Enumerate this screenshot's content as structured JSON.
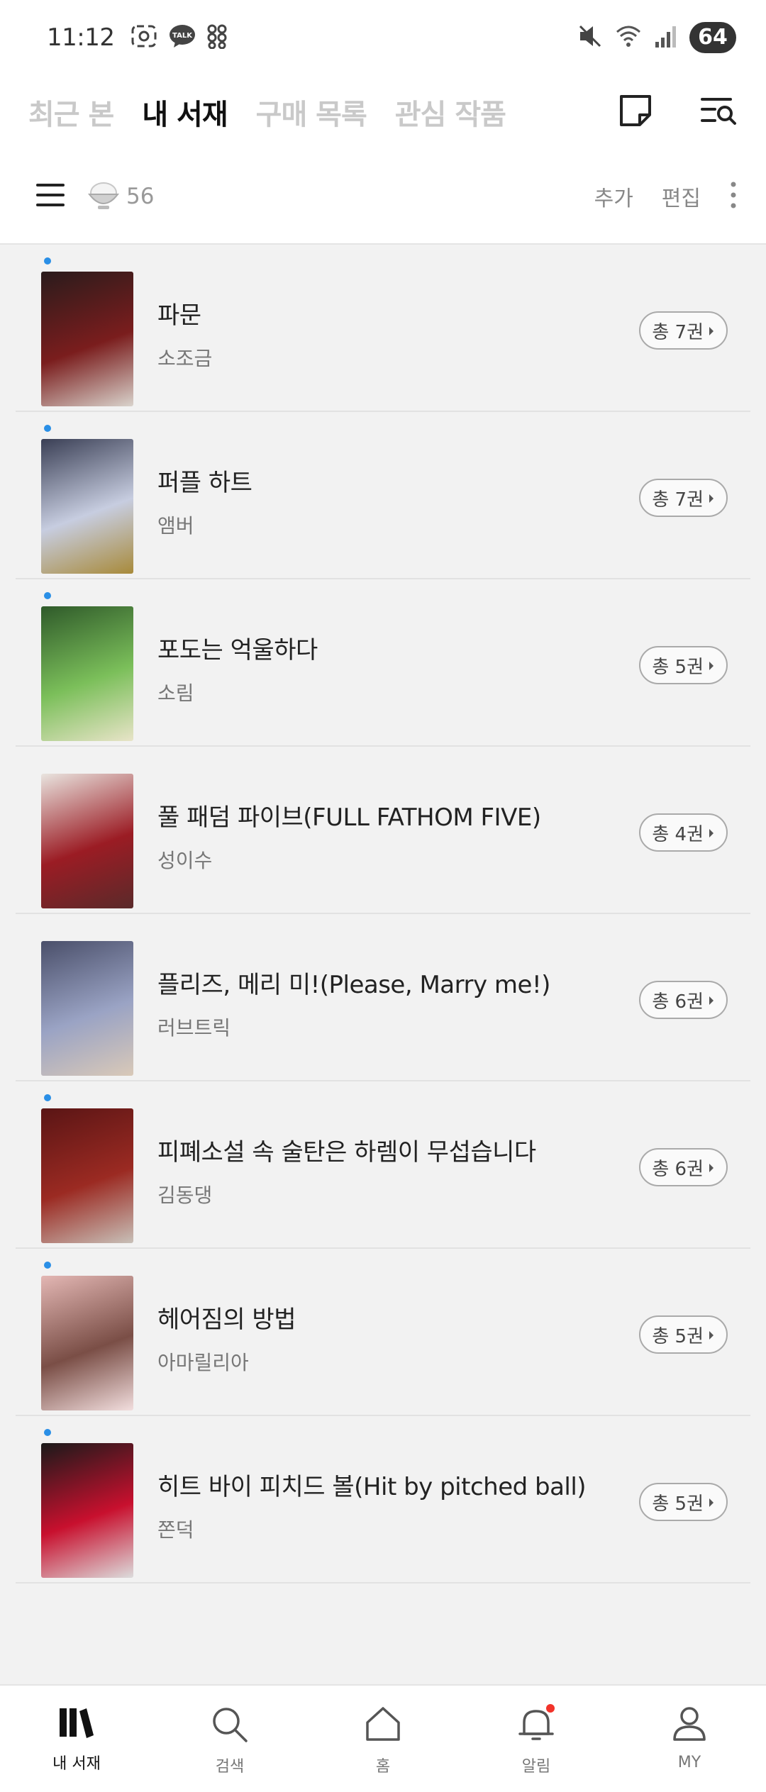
{
  "status_bar": {
    "time": "11:12",
    "battery": "64"
  },
  "top_nav": {
    "tabs": [
      {
        "label": "최근 본",
        "active": false
      },
      {
        "label": "내 서재",
        "active": true
      },
      {
        "label": "구매 목록",
        "active": false
      },
      {
        "label": "관심 작품",
        "active": false
      }
    ],
    "actions": {
      "note_icon": "note-icon",
      "search_list_icon": "list-search-icon"
    }
  },
  "toolbar": {
    "coin_count": "56",
    "add_label": "추가",
    "edit_label": "편집"
  },
  "books": [
    {
      "title": "파문",
      "author": "소조금",
      "volumes": "총 7권",
      "new": true,
      "cover_colors": [
        "#2a1b1c",
        "#7a1d1d",
        "#d9d3cc"
      ]
    },
    {
      "title": "퍼플 하트",
      "author": "앰버",
      "volumes": "총 7권",
      "new": true,
      "cover_colors": [
        "#3a3f55",
        "#c7cde0",
        "#a88a3a"
      ]
    },
    {
      "title": "포도는 억울하다",
      "author": "소림",
      "volumes": "총 5권",
      "new": true,
      "cover_colors": [
        "#2f5a2a",
        "#7bbf5a",
        "#e8e4c8"
      ]
    },
    {
      "title": "풀 패덤 파이브(FULL FATHOM FIVE)",
      "author": "성이수",
      "volumes": "총 4권",
      "new": false,
      "cover_colors": [
        "#e9e4df",
        "#9b1c24",
        "#5a2a2a"
      ]
    },
    {
      "title": "플리즈, 메리 미!(Please, Marry me!)",
      "author": "러브트릭",
      "volumes": "총 6권",
      "new": false,
      "cover_colors": [
        "#4a4f6a",
        "#9aa3c4",
        "#d9c9b8"
      ]
    },
    {
      "title": "피폐소설 속 술탄은 하렘이 무섭습니다",
      "author": "김동댕",
      "volumes": "총 6권",
      "new": true,
      "cover_colors": [
        "#5a1515",
        "#9b2a22",
        "#c8c0b8"
      ]
    },
    {
      "title": "헤어짐의 방법",
      "author": "아마릴리아",
      "volumes": "총 5권",
      "new": true,
      "cover_colors": [
        "#e3b7b4",
        "#7a4e46",
        "#f2dede"
      ]
    },
    {
      "title": "히트 바이 피치드 볼(Hit by pitched ball)",
      "author": "쫀덕",
      "volumes": "총 5권",
      "new": true,
      "cover_colors": [
        "#1a1a1a",
        "#c8102e",
        "#dcdcdc"
      ]
    }
  ],
  "bottom_nav": [
    {
      "label": "내 서재",
      "icon": "library-icon",
      "active": true
    },
    {
      "label": "검색",
      "icon": "search-icon",
      "active": false
    },
    {
      "label": "홈",
      "icon": "home-icon",
      "active": false
    },
    {
      "label": "알림",
      "icon": "bell-icon",
      "active": false,
      "badge": true
    },
    {
      "label": "MY",
      "icon": "person-icon",
      "active": false
    }
  ]
}
